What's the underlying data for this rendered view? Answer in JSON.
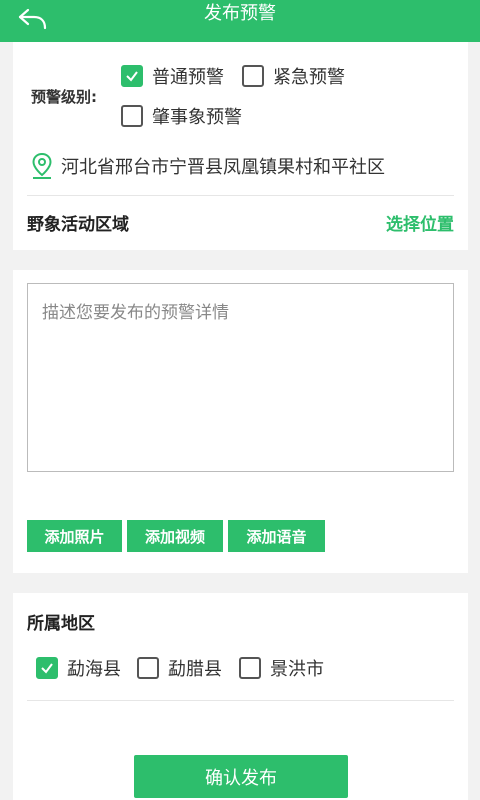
{
  "header": {
    "title": "发布预警"
  },
  "alert_level": {
    "label": "预警级别:",
    "options": [
      {
        "label": "普通预警",
        "checked": true
      },
      {
        "label": "紧急预警",
        "checked": false
      },
      {
        "label": "肇事象预警",
        "checked": false
      }
    ]
  },
  "location": {
    "address": "河北省邢台市宁晋县凤凰镇果村和平社区"
  },
  "activity_area": {
    "title": "野象活动区域",
    "select_label": "选择位置"
  },
  "description": {
    "placeholder": "描述您要发布的预警详情",
    "value": ""
  },
  "media_buttons": [
    "添加照片",
    "添加视频",
    "添加语音"
  ],
  "region": {
    "title": "所属地区",
    "options": [
      {
        "label": "勐海县",
        "checked": true
      },
      {
        "label": "勐腊县",
        "checked": false
      },
      {
        "label": "景洪市",
        "checked": false
      }
    ]
  },
  "confirm": {
    "label": "确认发布"
  },
  "colors": {
    "accent": "#2dbe6c",
    "background": "#f2f2f2"
  }
}
